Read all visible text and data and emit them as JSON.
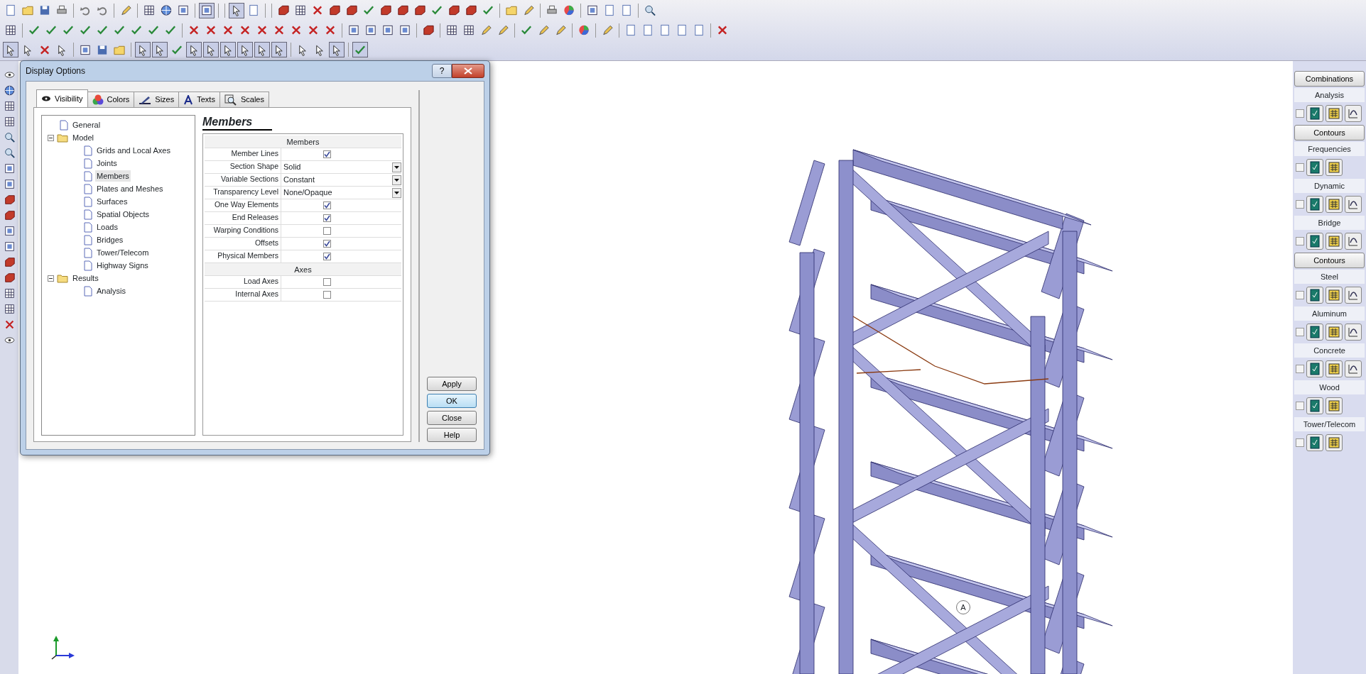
{
  "dialog": {
    "title": "Display Options",
    "help_button": "?",
    "tabs": [
      {
        "label": "Visibility",
        "selected": true
      },
      {
        "label": "Colors",
        "selected": false
      },
      {
        "label": "Sizes",
        "selected": false
      },
      {
        "label": "Texts",
        "selected": false
      },
      {
        "label": "Scales",
        "selected": false
      }
    ],
    "tree": [
      {
        "label": "General",
        "kind": "page",
        "selected": false
      },
      {
        "label": "Model",
        "kind": "folder",
        "expanded": true,
        "selected": false,
        "children": [
          {
            "label": "Grids and Local Axes",
            "kind": "page",
            "selected": false
          },
          {
            "label": "Joints",
            "kind": "page",
            "selected": false
          },
          {
            "label": "Members",
            "kind": "page",
            "selected": true
          },
          {
            "label": "Plates and Meshes",
            "kind": "page",
            "selected": false
          },
          {
            "label": "Surfaces",
            "kind": "page",
            "selected": false
          },
          {
            "label": "Spatial Objects",
            "kind": "page",
            "selected": false
          },
          {
            "label": "Loads",
            "kind": "page",
            "selected": false
          },
          {
            "label": "Bridges",
            "kind": "page",
            "selected": false
          },
          {
            "label": "Tower/Telecom",
            "kind": "page",
            "selected": false
          },
          {
            "label": "Highway Signs",
            "kind": "page",
            "selected": false
          }
        ]
      },
      {
        "label": "Results",
        "kind": "folder",
        "expanded": true,
        "selected": false,
        "children": [
          {
            "label": "Analysis",
            "kind": "page",
            "selected": false
          }
        ]
      }
    ],
    "panel_title": "Members",
    "sections": [
      {
        "heading": "Members",
        "rows": [
          {
            "label": "Member Lines",
            "kind": "checkbox",
            "checked": true
          },
          {
            "label": "Section Shape",
            "kind": "dropdown",
            "value": "Solid"
          },
          {
            "label": "Variable Sections",
            "kind": "dropdown",
            "value": "Constant"
          },
          {
            "label": "Transparency Level",
            "kind": "dropdown",
            "value": "None/Opaque"
          },
          {
            "label": "One Way Elements",
            "kind": "checkbox",
            "checked": true
          },
          {
            "label": "End Releases",
            "kind": "checkbox",
            "checked": true
          },
          {
            "label": "Warping Conditions",
            "kind": "checkbox",
            "checked": false
          },
          {
            "label": "Offsets",
            "kind": "checkbox",
            "checked": true
          },
          {
            "label": "Physical Members",
            "kind": "checkbox",
            "checked": true
          }
        ]
      },
      {
        "heading": "Axes",
        "rows": [
          {
            "label": "Load Axes",
            "kind": "checkbox",
            "checked": false
          },
          {
            "label": "Internal Axes",
            "kind": "checkbox",
            "checked": false
          }
        ]
      }
    ],
    "buttons": [
      {
        "label": "Apply",
        "default": false
      },
      {
        "label": "OK",
        "default": true
      },
      {
        "label": "Close",
        "default": false
      },
      {
        "label": "Help",
        "default": false
      }
    ]
  },
  "results_panel": [
    {
      "kind": "button",
      "label": "Combinations"
    },
    {
      "kind": "header",
      "label": "Analysis"
    },
    {
      "kind": "full-row",
      "checked": false
    },
    {
      "kind": "button",
      "label": "Contours"
    },
    {
      "kind": "header",
      "label": "Frequencies"
    },
    {
      "kind": "short-row",
      "checked": false
    },
    {
      "kind": "header",
      "label": "Dynamic"
    },
    {
      "kind": "full-row",
      "checked": false
    },
    {
      "kind": "header",
      "label": "Bridge"
    },
    {
      "kind": "full-row",
      "checked": false
    },
    {
      "kind": "button",
      "label": "Contours"
    },
    {
      "kind": "header",
      "label": "Steel"
    },
    {
      "kind": "full-row",
      "checked": false
    },
    {
      "kind": "header",
      "label": "Aluminum"
    },
    {
      "kind": "full-row",
      "checked": false
    },
    {
      "kind": "header",
      "label": "Concrete"
    },
    {
      "kind": "full-row",
      "checked": false
    },
    {
      "kind": "header",
      "label": "Wood"
    },
    {
      "kind": "short-row",
      "checked": false
    },
    {
      "kind": "header",
      "label": "Tower/Telecom"
    },
    {
      "kind": "short-row",
      "checked": false
    }
  ],
  "viewport": {
    "marker": "A"
  }
}
